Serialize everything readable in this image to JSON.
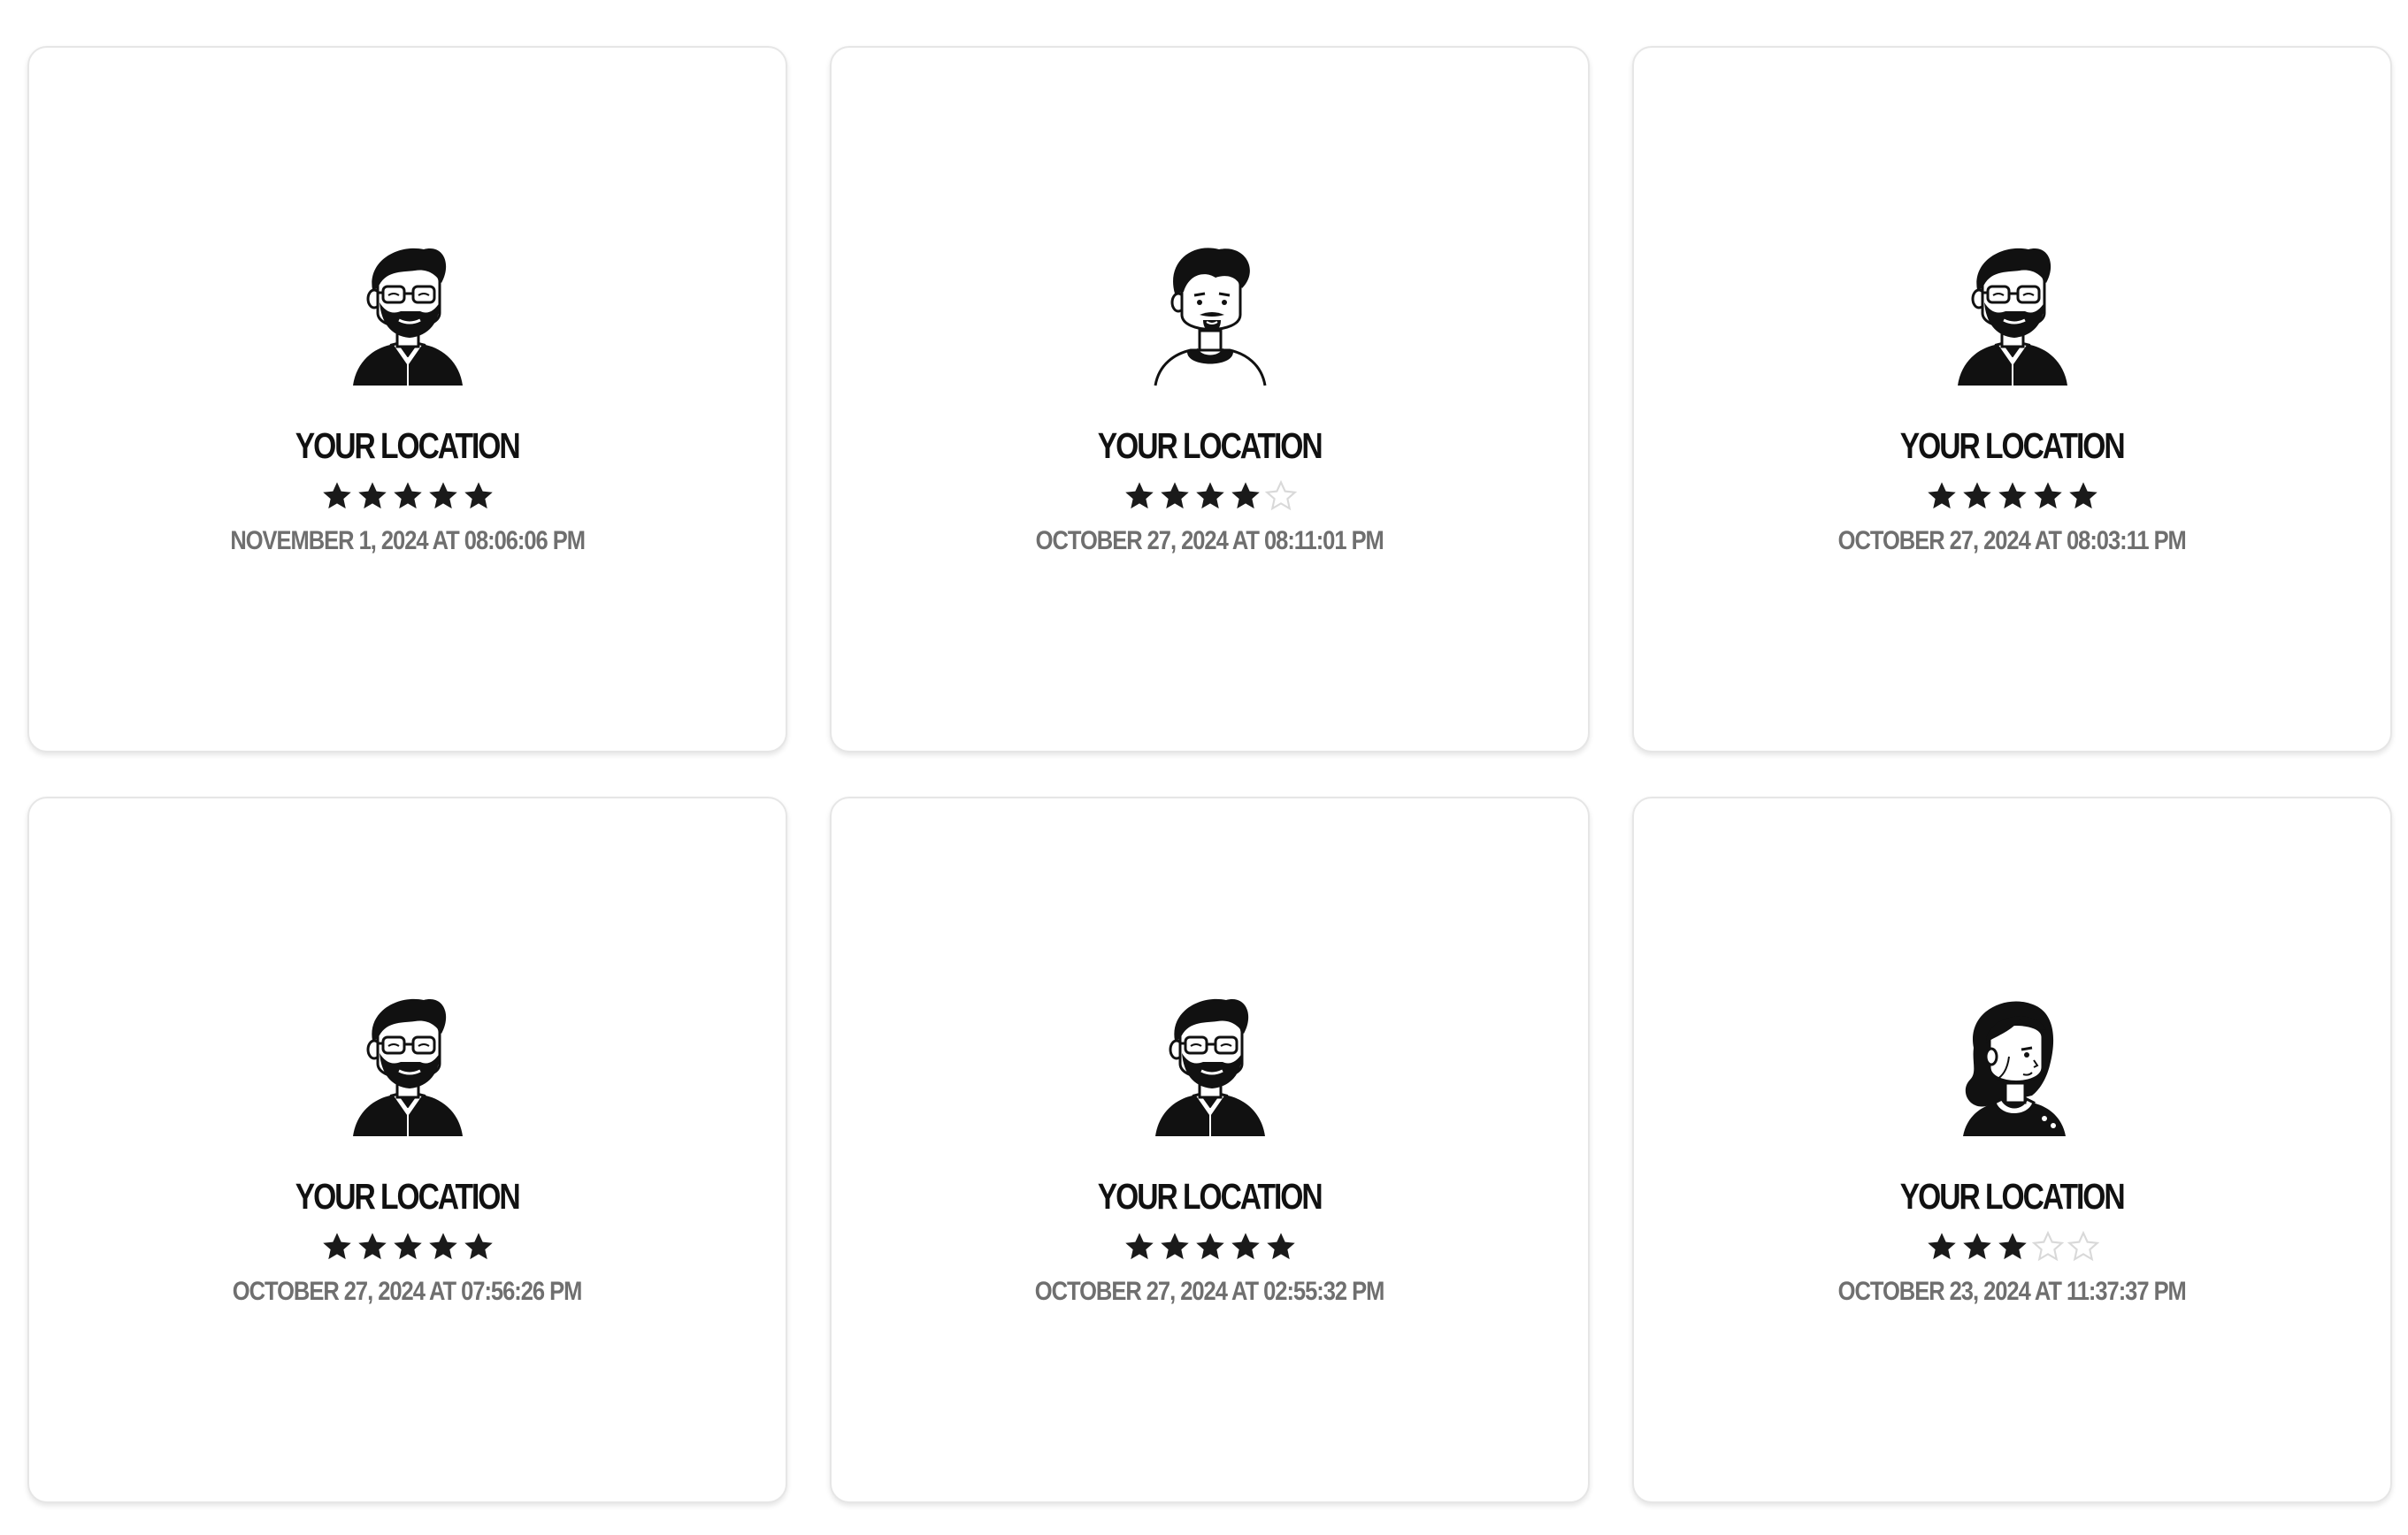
{
  "reviews": [
    {
      "location": "YOUR LOCATION",
      "rating": 5,
      "date": "NOVEMBER 1, 2024 AT 08:06:06 PM",
      "avatar": "bearded-man-glasses-icon"
    },
    {
      "location": "YOUR LOCATION",
      "rating": 4,
      "date": "OCTOBER 27, 2024 AT 08:11:01 PM",
      "avatar": "man-goatee-icon"
    },
    {
      "location": "YOUR LOCATION",
      "rating": 5,
      "date": "OCTOBER 27, 2024 AT 08:03:11 PM",
      "avatar": "bearded-man-glasses-icon"
    },
    {
      "location": "YOUR LOCATION",
      "rating": 5,
      "date": "OCTOBER 27, 2024 AT 07:56:26 PM",
      "avatar": "bearded-man-glasses-icon"
    },
    {
      "location": "YOUR LOCATION",
      "rating": 5,
      "date": "OCTOBER 27, 2024 AT 02:55:32 PM",
      "avatar": "bearded-man-glasses-icon"
    },
    {
      "location": "YOUR LOCATION",
      "rating": 3,
      "date": "OCTOBER 23, 2024 AT 11:37:37 PM",
      "avatar": "woman-long-hair-icon"
    }
  ],
  "rating_max": 5,
  "colors": {
    "star_filled": "#1a1a1a",
    "star_empty_stroke": "#d9d9d9",
    "date_text": "#6f6f6f",
    "title_text": "#111111",
    "card_border": "#e6e6e6"
  }
}
